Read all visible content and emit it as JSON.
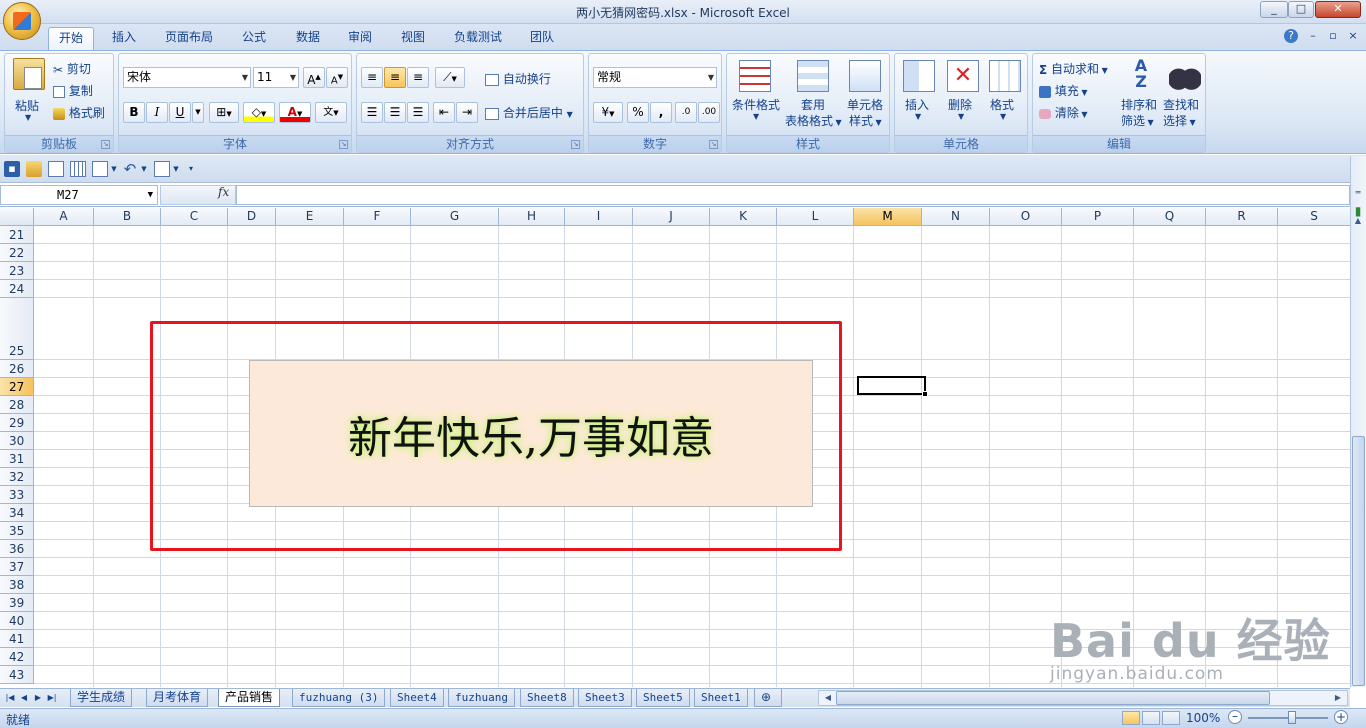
{
  "window": {
    "title": "两小无猜网密码.xlsx - Microsoft Excel",
    "controls": [
      "_",
      "□",
      "✕"
    ]
  },
  "tabs": [
    "开始",
    "插入",
    "页面布局",
    "公式",
    "数据",
    "审阅",
    "视图",
    "负载测试",
    "团队"
  ],
  "active_tab": "开始",
  "ribbon": {
    "clipboard": {
      "label": "剪贴板",
      "paste": "粘贴",
      "cut": "剪切",
      "copy": "复制",
      "format_painter": "格式刷"
    },
    "font": {
      "label": "字体",
      "font_name": "宋体",
      "font_size": "11"
    },
    "alignment": {
      "label": "对齐方式",
      "wrap_text": "自动换行",
      "merge_center": "合并后居中"
    },
    "number": {
      "label": "数字",
      "format": "常规",
      "percent": "%",
      "comma": ","
    },
    "styles": {
      "label": "样式",
      "conditional": "条件格式",
      "table_1": "套用",
      "table_2": "表格格式",
      "cell_1": "单元格",
      "cell_2": "样式"
    },
    "cells": {
      "label": "单元格",
      "insert": "插入",
      "delete": "删除",
      "format": "格式"
    },
    "editing": {
      "label": "编辑",
      "autosum": "自动求和",
      "fill": "填充",
      "clear": "清除",
      "sort_1": "排序和",
      "sort_2": "筛选",
      "find_1": "查找和",
      "find_2": "选择"
    }
  },
  "formula_bar": {
    "name_box": "M27",
    "fx": "fx",
    "formula": ""
  },
  "columns": [
    "A",
    "B",
    "C",
    "D",
    "E",
    "F",
    "G",
    "H",
    "I",
    "J",
    "K",
    "L",
    "M",
    "N",
    "O",
    "P",
    "Q",
    "R",
    "S"
  ],
  "selected_column": "M",
  "rows": [
    "21",
    "22",
    "23",
    "24",
    "25",
    "26",
    "27",
    "28",
    "29",
    "30",
    "31",
    "32",
    "33",
    "34",
    "35",
    "36",
    "37",
    "38",
    "39",
    "40",
    "41",
    "42",
    "43"
  ],
  "selected_row": "27",
  "textbox": {
    "text": "新年快乐,万事如意"
  },
  "sheets": [
    "学生成绩",
    "月考体育",
    "产品销售",
    "fuzhuang (3)",
    "Sheet4",
    "fuzhuang",
    "Sheet8",
    "Sheet3",
    "Sheet5",
    "Sheet1"
  ],
  "active_sheet": "产品销售",
  "status": {
    "ready": "就绪",
    "zoom": "100%"
  },
  "watermark": {
    "brand": "Bai du 经验",
    "url": "jingyan.baidu.com"
  }
}
